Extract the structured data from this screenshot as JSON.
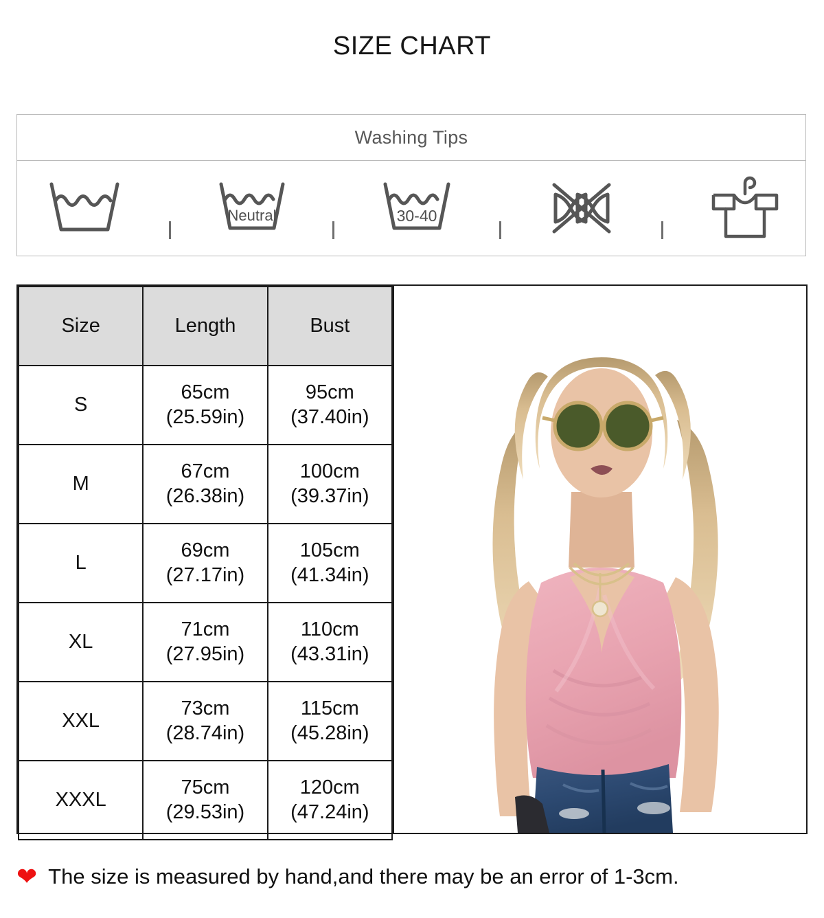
{
  "page": {
    "title": "SIZE CHART",
    "background": "#ffffff",
    "text_color": "#111111"
  },
  "washing": {
    "heading": "Washing Tips",
    "heading_color": "#585858",
    "icon_color": "#565656",
    "items": [
      {
        "icon": "machine-wash-icon",
        "label": ""
      },
      {
        "icon": "neutral-detergent-wash-icon",
        "label": "Neutral"
      },
      {
        "icon": "wash-temperature-icon",
        "label": "30-40"
      },
      {
        "icon": "do-not-wring-icon",
        "label": ""
      },
      {
        "icon": "hang-dry-icon",
        "label": ""
      }
    ]
  },
  "size_table": {
    "header_bg": "#dcdcdc",
    "border_color": "#1b1b1b",
    "columns": [
      "Size",
      "Length",
      "Bust"
    ],
    "rows": [
      {
        "size": "S",
        "length_cm": "65cm",
        "length_in": "(25.59in)",
        "bust_cm": "95cm",
        "bust_in": "(37.40in)"
      },
      {
        "size": "M",
        "length_cm": "67cm",
        "length_in": "(26.38in)",
        "bust_cm": "100cm",
        "bust_in": "(39.37in)"
      },
      {
        "size": "L",
        "length_cm": "69cm",
        "length_in": "(27.17in)",
        "bust_cm": "105cm",
        "bust_in": "(41.34in)"
      },
      {
        "size": "XL",
        "length_cm": "71cm",
        "length_in": "(27.95in)",
        "bust_cm": "110cm",
        "bust_in": "(43.31in)"
      },
      {
        "size": "XXL",
        "length_cm": "73cm",
        "length_in": "(28.74in)",
        "bust_cm": "115cm",
        "bust_in": "(45.28in)"
      },
      {
        "size": "XXXL",
        "length_cm": "75cm",
        "length_in": "(29.53in)",
        "bust_cm": "120cm",
        "bust_in": "(47.24in)"
      }
    ]
  },
  "product_photo": {
    "description": "Blonde woman in pink sleeveless draped V-neck top with blue ripped jeans, wearing round green-lens sunglasses and layered necklaces, holding a dark clutch",
    "top_color": "#e8a3b0",
    "jeans_color": "#2d4a72",
    "hair_color": "#d9bd91",
    "skin_color": "#e9c3a6",
    "lens_color": "#4a5a2a"
  },
  "footer": {
    "heart_icon": "heart-icon",
    "heart_color": "#ee1111",
    "note": "The size is measured by hand,and there may be an error of 1-3cm."
  }
}
